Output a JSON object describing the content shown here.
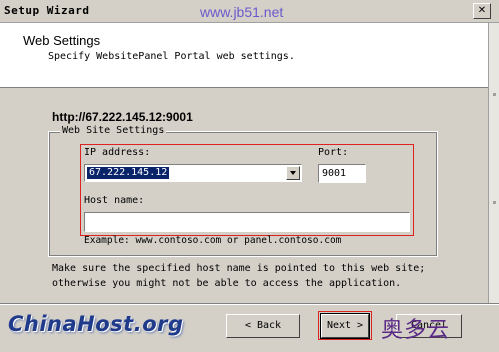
{
  "window": {
    "title": "Setup Wizard",
    "watermark": "www.jb51.net"
  },
  "header": {
    "title": "Web Settings",
    "subtitle": "Specify WebsitePanel Portal web settings."
  },
  "url": "http://67.222.145.12:9001",
  "group": {
    "legend": "Web Site Settings",
    "ip_label": "IP address:",
    "ip_value": "67.222.145.12",
    "port_label": "Port:",
    "port_value": "9001",
    "host_label": "Host name:",
    "host_value": "",
    "example": "Example: www.contoso.com or panel.contoso.com"
  },
  "note": {
    "line1": "Make sure the specified host name is pointed to this web site;",
    "line2": "otherwise you might not be able to access the application."
  },
  "buttons": {
    "back": "< Back",
    "next": "Next >",
    "cancel": "Cancel"
  },
  "branding": {
    "left_logo": "ChinaHost.org",
    "right_logo": "奥多云"
  },
  "colors": {
    "highlight_red": "#dd2222",
    "selection_blue": "#0a246a"
  }
}
